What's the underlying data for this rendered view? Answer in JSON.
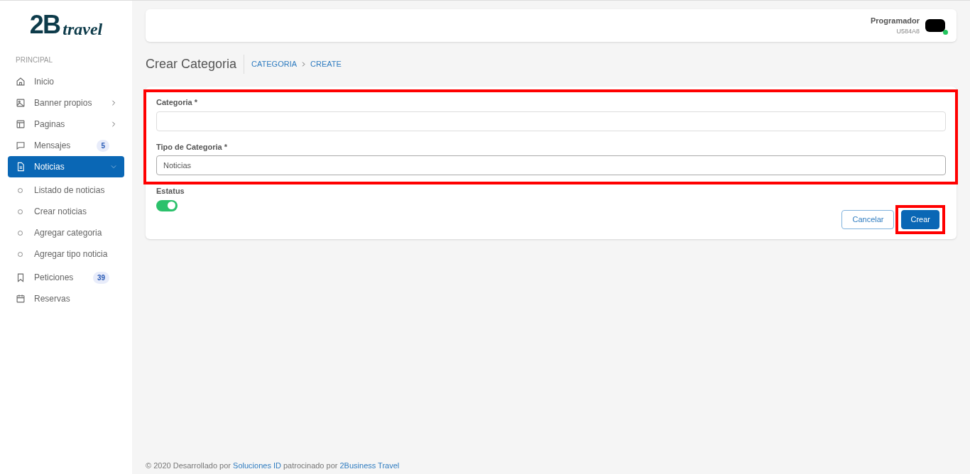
{
  "logo": {
    "mark": "2B",
    "word": "travel"
  },
  "sidebar": {
    "section": "PRINCIPAL",
    "items": [
      {
        "label": "Inicio",
        "selected": false
      },
      {
        "label": "Banner propios",
        "selected": false,
        "has_submenu": true
      },
      {
        "label": "Paginas",
        "selected": false,
        "has_submenu": true
      },
      {
        "label": "Mensajes",
        "selected": false,
        "badge": "5"
      },
      {
        "label": "Noticias",
        "selected": true,
        "has_submenu": true,
        "expanded": true,
        "children": [
          {
            "label": "Listado de noticias",
            "selected": false
          },
          {
            "label": "Crear noticias",
            "selected": false
          },
          {
            "label": "Agregar categoria",
            "selected": false
          },
          {
            "label": "Agregar tipo noticia",
            "selected": false
          }
        ]
      },
      {
        "label": "Peticiones",
        "selected": false,
        "badge": "39"
      },
      {
        "label": "Reservas",
        "selected": false
      }
    ]
  },
  "user": {
    "name": "Programador",
    "code": "U584A8",
    "online": true
  },
  "page": {
    "title": "Crear Categoria",
    "breadcrumb": [
      "CATEGORIA",
      "CREATE"
    ]
  },
  "form": {
    "fields": [
      {
        "kind": "text",
        "label": "Categoria *"
      },
      {
        "kind": "select",
        "label": "Tipo de Categoria *",
        "value": "Noticias"
      },
      {
        "kind": "switch",
        "label": "Estatus",
        "on": true
      }
    ],
    "buttons": [
      {
        "label": "Cancelar",
        "kind": "outline"
      },
      {
        "label": "Crear",
        "kind": "primary"
      }
    ]
  },
  "footer": [
    {
      "text": "© 2020 Desarrollado por ",
      "link": false
    },
    {
      "text": "Soluciones ID",
      "link": true
    },
    {
      "text": " patrocinado por ",
      "link": false
    },
    {
      "text": "2Business Travel",
      "link": true
    }
  ]
}
